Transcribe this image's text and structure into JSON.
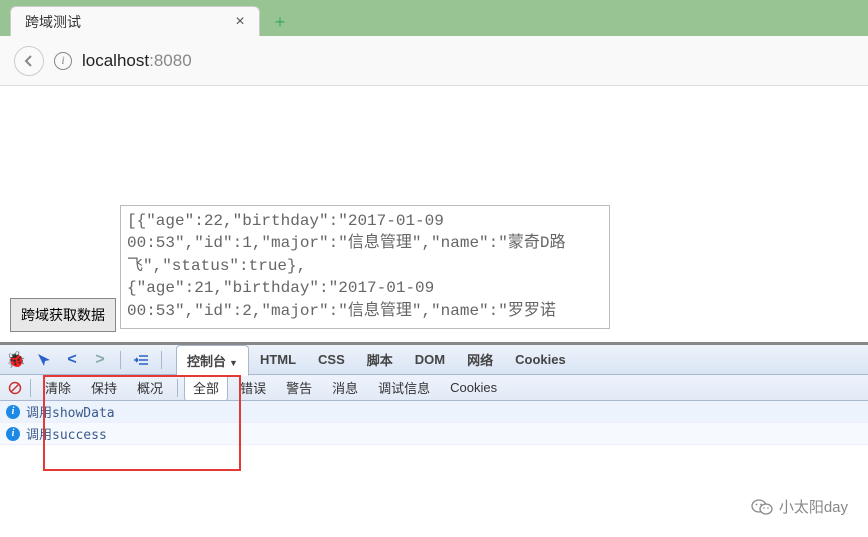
{
  "browser": {
    "tab_title": "跨域测试",
    "url_host": "localhost",
    "url_port": ":8080"
  },
  "page": {
    "fetch_button": "跨域获取数据",
    "textarea_value": "[{\"age\":22,\"birthday\":\"2017-01-09 00:53\",\"id\":1,\"major\":\"信息管理\",\"name\":\"蒙奇D路飞\",\"status\":true},\n{\"age\":21,\"birthday\":\"2017-01-09 00:53\",\"id\":2,\"major\":\"信息管理\",\"name\":\"罗罗诺"
  },
  "devtools": {
    "tabs": {
      "console": "控制台",
      "html": "HTML",
      "css": "CSS",
      "script": "脚本",
      "dom": "DOM",
      "net": "网络",
      "cookies": "Cookies"
    },
    "subbar": {
      "clear": "清除",
      "persist": "保持",
      "profile": "概况",
      "all": "全部",
      "errors": "错误",
      "warnings": "警告",
      "info": "消息",
      "debug": "调试信息",
      "cookies": "Cookies"
    },
    "console_rows": [
      "调用showData",
      "调用success"
    ]
  },
  "watermark": "小太阳day"
}
